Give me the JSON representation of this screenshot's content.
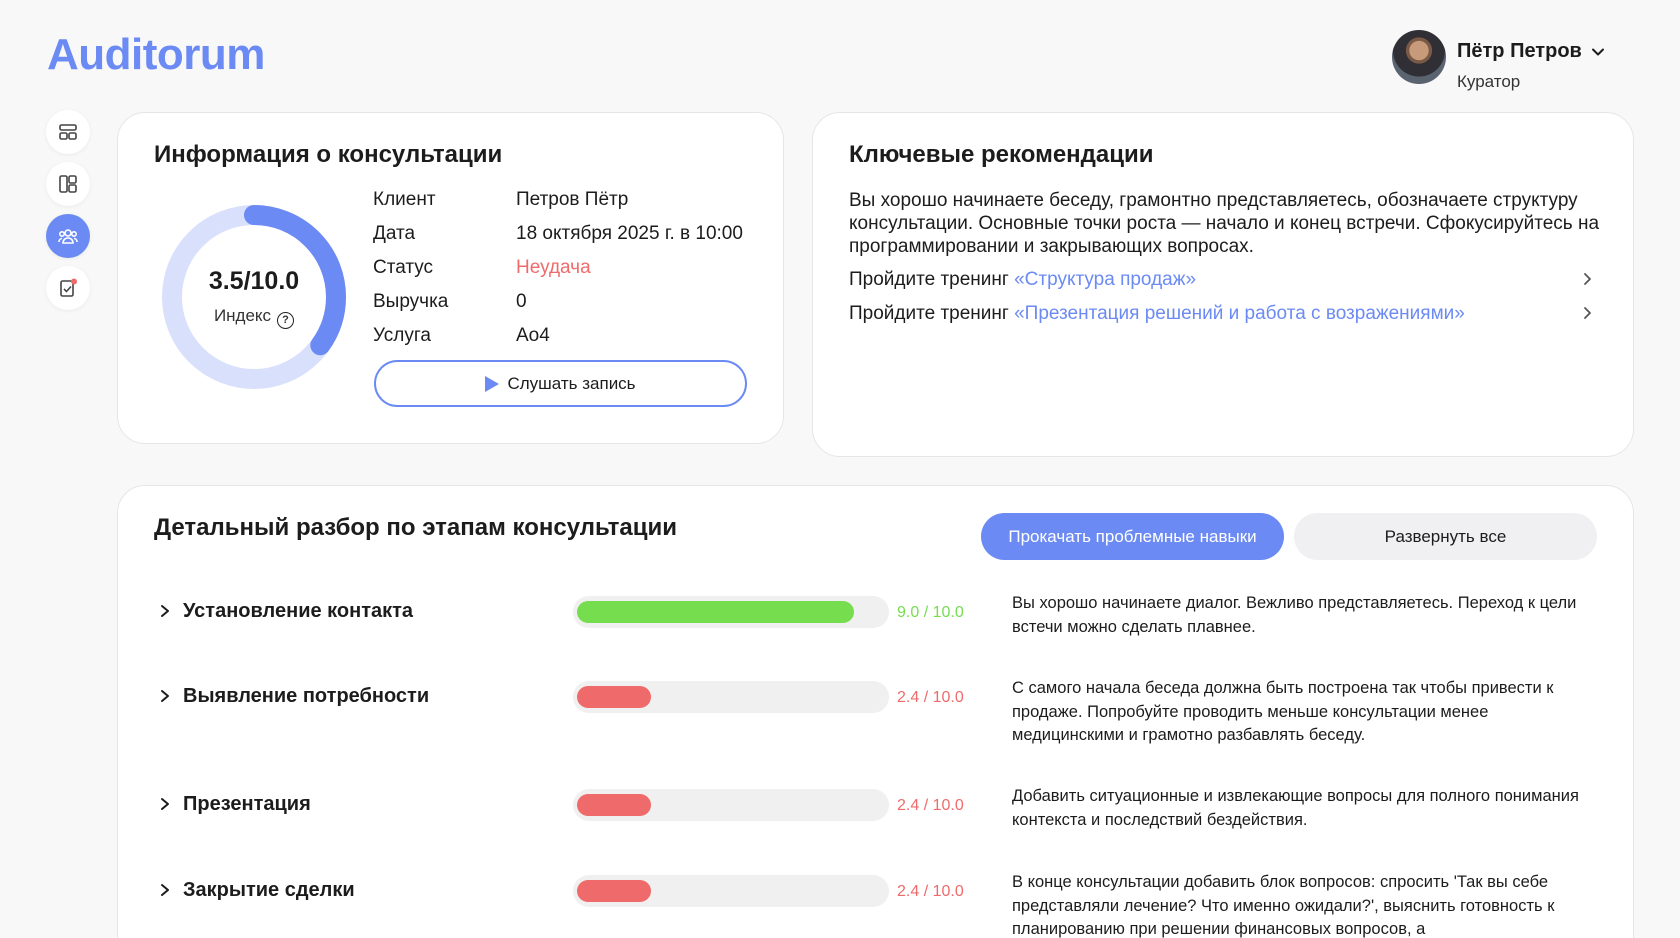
{
  "app": {
    "logo": "Auditorum"
  },
  "user": {
    "name": "Пётр Петров",
    "role": "Куратор"
  },
  "sidebar": {
    "items": [
      {
        "icon": "dashboard-icon",
        "active": false
      },
      {
        "icon": "layout-icon",
        "active": false
      },
      {
        "icon": "team-icon",
        "active": true
      },
      {
        "icon": "tasks-icon",
        "active": false,
        "badge_color": "#ef6b6b"
      }
    ]
  },
  "info": {
    "title": "Информация о консультации",
    "index_value": "3.5/10.0",
    "index_fraction": 0.35,
    "index_label": "Индекс",
    "fields": [
      {
        "key": "Клиент",
        "value": "Петров Пётр"
      },
      {
        "key": "Дата",
        "value": "18 октября 2025 г. в 10:00"
      },
      {
        "key": "Статус",
        "value": "Неудача"
      },
      {
        "key": "Выручка",
        "value": "0"
      },
      {
        "key": "Услуга",
        "value": "Ао4"
      }
    ],
    "listen_label": "Слушать запись"
  },
  "recommendations": {
    "title": "Ключевые рекомендации",
    "summary": "Вы хорошо начинаете беседу, грамонтно представляетесь, обозначаете структуру консультации. Основные точки роста — начало и конец встречи. Сфокусируйтесь на программировании и закрывающих вопросах.",
    "trainings": [
      {
        "prefix": "Пройдите тренинг ",
        "link": "«Структура продаж»"
      },
      {
        "prefix": "Пройдите тренинг ",
        "link": "«Презентация решений и работа с возражениями»"
      }
    ]
  },
  "detail": {
    "title": "Детальный разбор по этапам консультации",
    "primary_button": "Прокачать проблемные навыки",
    "secondary_button": "Развернуть все",
    "stages": [
      {
        "name": "Установление контакта",
        "score": 9.0,
        "score_label": "9.0 / 10.0",
        "status": "good",
        "comment": "Вы хорошо начинаете диалог. Вежливо представляетесь. Переход к цели встечи можно сделать плавнее."
      },
      {
        "name": "Выявление потребности",
        "score": 2.4,
        "score_label": "2.4 / 10.0",
        "status": "bad",
        "comment": "С самого начала беседа должна быть построена так чтобы привести к продаже. Попробуйте проводить меньше консультации менее медицинскими и грамотно разбавлять беседу."
      },
      {
        "name": "Презентация",
        "score": 2.4,
        "score_label": "2.4 / 10.0",
        "status": "bad",
        "comment": "Добавить ситуационные и извлекающие вопросы для полного понимания контекста и последствий бездействия."
      },
      {
        "name": "Закрытие сделки",
        "score": 2.4,
        "score_label": "2.4 / 10.0",
        "status": "bad",
        "comment": "В конце консультации добавить блок вопросов: спросить 'Так вы себе представляли лечение? Что именно ожидали?', выяснить готовность к планированию при решении финансовых вопросов, а"
      }
    ]
  },
  "colors": {
    "accent": "#6b8af3",
    "good": "#76dd4f",
    "bad": "#ef6b6b",
    "track": "#d9e0fb"
  }
}
